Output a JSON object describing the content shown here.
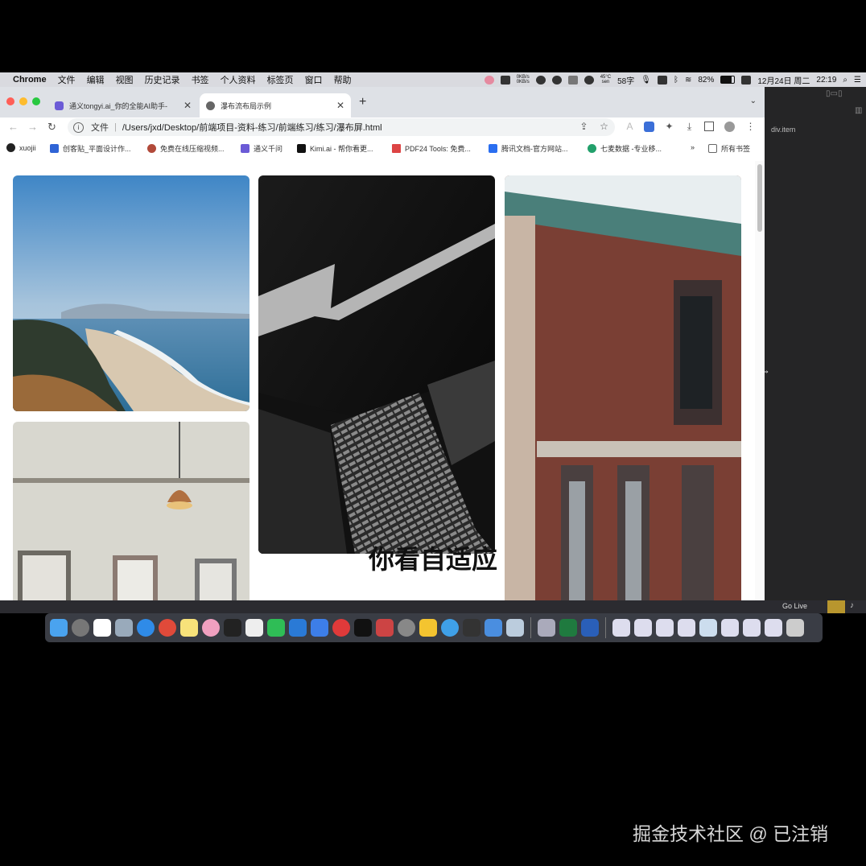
{
  "menubar": {
    "app": "Chrome",
    "items": [
      "文件",
      "编辑",
      "视图",
      "历史记录",
      "书签",
      "个人资料",
      "标签页",
      "窗口",
      "帮助"
    ],
    "net_up": "0KB/s",
    "net_down": "0KB/s",
    "temp": "45°C",
    "temp_unit": "sen",
    "chars": "58字",
    "battery": "82%",
    "date": "12月24日 周二",
    "time": "22:19"
  },
  "tabs": [
    {
      "title": "通义tongyi.ai_你的全能AI助手-",
      "active": false
    },
    {
      "title": "瀑布流布局示例",
      "active": true
    }
  ],
  "toolbar": {
    "scheme_label": "文件",
    "url": "/Users/jxd/Desktop/前端项目-资料-练习/前端练习/练习/瀑布屏.html"
  },
  "bookmarks": [
    "xuojii",
    "创客贴_平面设计作...",
    "免费在线压缩视频...",
    "通义千问",
    "Kimi.ai - 帮你看更...",
    "PDF24 Tools: 免费...",
    "腾讯文档-官方网站...",
    "七麦数据 -专业移...",
    "所有书签"
  ],
  "page": {
    "overlay_text": "你看自适应",
    "images": [
      {
        "alt": "coastal beach landscape"
      },
      {
        "alt": "black and white skyscraper"
      },
      {
        "alt": "red brick building facade"
      },
      {
        "alt": "interior with pendant lamp and frames"
      }
    ]
  },
  "editor": {
    "breadcrumb": "div.item"
  },
  "statusbar": {
    "golive": "Go Live"
  },
  "watermark": "掘金技术社区 @ 已注销",
  "colors": {
    "close": "#ff5f57",
    "minimize": "#febc2e",
    "maximize": "#28c840"
  }
}
